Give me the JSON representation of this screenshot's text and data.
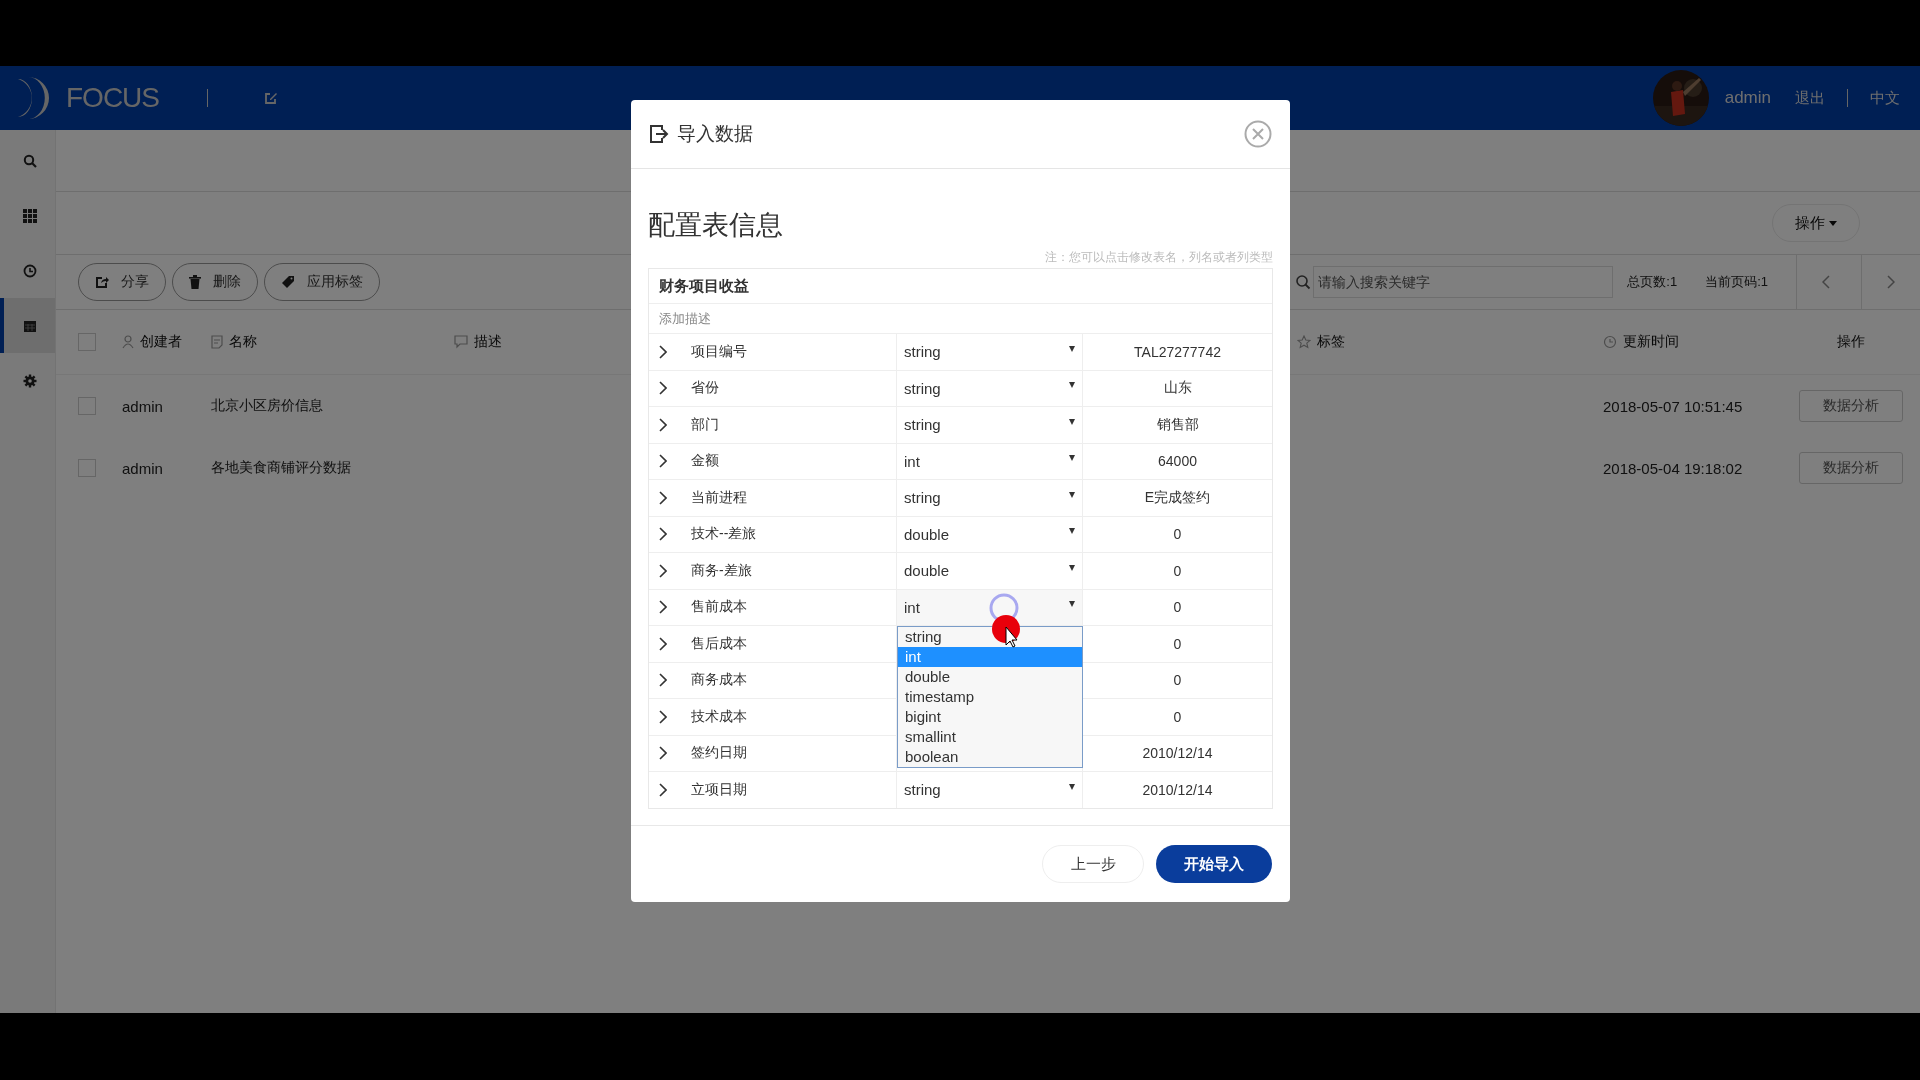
{
  "header": {
    "logo_text": "FOCUS",
    "user": "admin",
    "links": [
      "退出",
      "中文"
    ]
  },
  "sidebar": {
    "items": [
      {
        "kind": "search",
        "selected": false
      },
      {
        "kind": "grid",
        "selected": false
      },
      {
        "kind": "clock",
        "selected": false
      },
      {
        "kind": "list",
        "selected": true
      },
      {
        "kind": "gear",
        "selected": false
      }
    ]
  },
  "toolbar": {
    "action_menu": "操作",
    "buttons": [
      {
        "kind": "share",
        "label": "分享"
      },
      {
        "kind": "delete",
        "label": "删除"
      },
      {
        "kind": "tag",
        "label": "应用标签"
      }
    ],
    "search": {
      "placeholder": "请输入搜索关键字"
    },
    "total_pages": "总页数:1",
    "current_page": "当前页码:1"
  },
  "table": {
    "select_all_checked": false,
    "columns": [
      {
        "kind": "user",
        "label": "创建者"
      },
      {
        "kind": "doc",
        "label": "名称"
      },
      {
        "kind": "comment",
        "label": "描述"
      },
      {
        "kind": "star",
        "label": "标签"
      },
      {
        "kind": "clock",
        "label": "更新时间"
      },
      {
        "kind": "none",
        "label": "操作"
      }
    ],
    "rows": [
      {
        "checked": false,
        "creator": "admin",
        "name": "北京小区房价信息",
        "updated": "2018-05-07 10:51:45",
        "action": "数据分析"
      },
      {
        "checked": false,
        "creator": "admin",
        "name": "各地美食商铺评分数据",
        "updated": "2018-05-04 19:18:02",
        "action": "数据分析"
      }
    ]
  },
  "modal": {
    "title": "导入数据",
    "heading": "配置表信息",
    "note": "注：您可以点击修改表名，列名或者列类型",
    "table_name": "财务项目收益",
    "description_placeholder": "添加描述",
    "fields": [
      {
        "name": "项目编号",
        "type": "string",
        "sample": "TAL27277742",
        "dropdown_open": false
      },
      {
        "name": "省份",
        "type": "string",
        "sample": "山东",
        "dropdown_open": false
      },
      {
        "name": "部门",
        "type": "string",
        "sample": "销售部",
        "dropdown_open": false
      },
      {
        "name": "金额",
        "type": "int",
        "sample": "64000",
        "dropdown_open": false
      },
      {
        "name": "当前进程",
        "type": "string",
        "sample": "E完成签约",
        "dropdown_open": false
      },
      {
        "name": "技术--差旅",
        "type": "double",
        "sample": "0",
        "dropdown_open": false
      },
      {
        "name": "商务-差旅",
        "type": "double",
        "sample": "0",
        "dropdown_open": false
      },
      {
        "name": "售前成本",
        "type": "int",
        "sample": "0",
        "dropdown_open": true
      },
      {
        "name": "售后成本",
        "sample": "0"
      },
      {
        "name": "商务成本",
        "sample": "0"
      },
      {
        "name": "技术成本",
        "sample": "0"
      },
      {
        "name": "签约日期",
        "sample": "2010/12/14"
      },
      {
        "name": "立项日期",
        "type": "string",
        "sample": "2010/12/14",
        "dropdown_open": false
      }
    ],
    "type_options": [
      {
        "label": "string",
        "selected": false
      },
      {
        "label": "int",
        "selected": true
      },
      {
        "label": "double",
        "selected": false
      },
      {
        "label": "timestamp",
        "selected": false
      },
      {
        "label": "bigint",
        "selected": false
      },
      {
        "label": "smallint",
        "selected": false
      },
      {
        "label": "boolean",
        "selected": false
      }
    ],
    "buttons": {
      "back": "上一步",
      "start": "开始导入"
    }
  }
}
